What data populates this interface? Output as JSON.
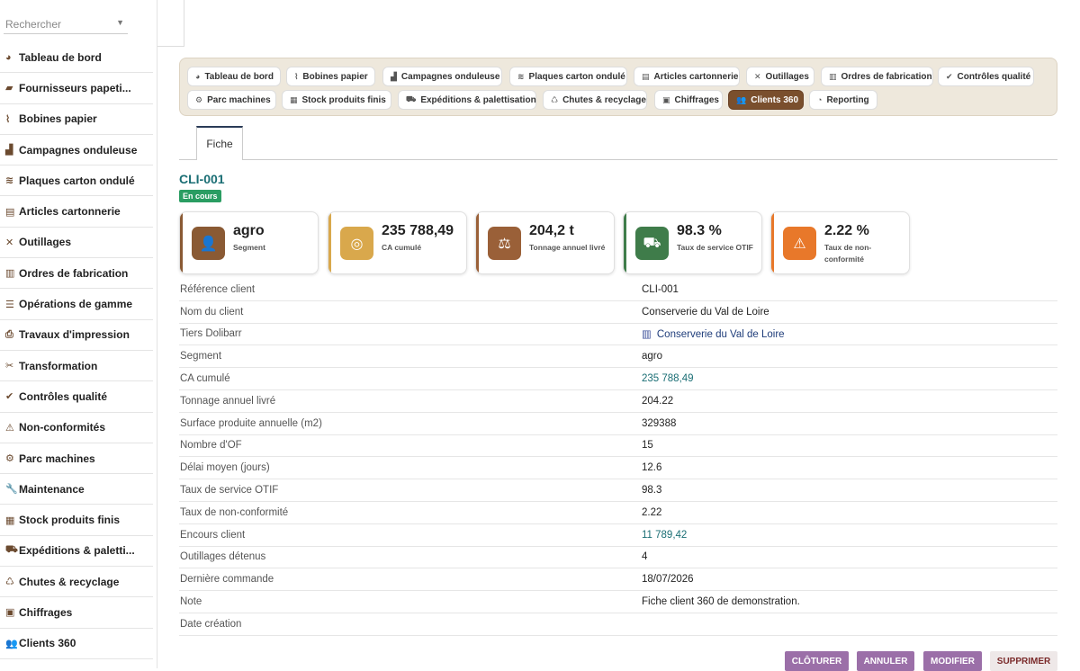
{
  "sidebar": {
    "search_placeholder": "Rechercher",
    "items": [
      {
        "icon": "gauge-icon",
        "glyph": "◕",
        "label": "Tableau de bord"
      },
      {
        "icon": "truck-paper-icon",
        "glyph": "▰",
        "label": "Fournisseurs papeti..."
      },
      {
        "icon": "paper-roll-icon",
        "glyph": "⌇",
        "label": "Bobines papier"
      },
      {
        "icon": "industry-icon",
        "glyph": "▟",
        "label": "Campagnes onduleuse"
      },
      {
        "icon": "layers-icon",
        "glyph": "≋",
        "label": "Plaques carton ondulé"
      },
      {
        "icon": "box-icon",
        "glyph": "▤",
        "label": "Articles cartonnerie"
      },
      {
        "icon": "tools-icon",
        "glyph": "✕",
        "label": "Outillages"
      },
      {
        "icon": "clipboard-icon",
        "glyph": "▥",
        "label": "Ordres de fabrication"
      },
      {
        "icon": "list-icon",
        "glyph": "☰",
        "label": "Opérations de gamme"
      },
      {
        "icon": "printer-icon",
        "glyph": "⎙",
        "label": "Travaux d'impression"
      },
      {
        "icon": "scissors-icon",
        "glyph": "✂",
        "label": "Transformation"
      },
      {
        "icon": "check-circle-icon",
        "glyph": "✔",
        "label": "Contrôles qualité"
      },
      {
        "icon": "warning-icon",
        "glyph": "⚠",
        "label": "Non-conformités"
      },
      {
        "icon": "cogs-icon",
        "glyph": "⚙",
        "label": "Parc machines"
      },
      {
        "icon": "wrench-icon",
        "glyph": "🔧",
        "label": "Maintenance"
      },
      {
        "icon": "warehouse-icon",
        "glyph": "▦",
        "label": "Stock produits finis"
      },
      {
        "icon": "shipping-icon",
        "glyph": "⛟",
        "label": "Expéditions & paletti..."
      },
      {
        "icon": "recycle-icon",
        "glyph": "♺",
        "label": "Chutes & recyclage"
      },
      {
        "icon": "calculator-icon",
        "glyph": "▣",
        "label": "Chiffrages"
      },
      {
        "icon": "users-icon",
        "glyph": "👥",
        "label": "Clients 360"
      }
    ]
  },
  "tabs": [
    {
      "icon": "gauge-icon",
      "glyph": "◕",
      "label": "Tableau de bord"
    },
    {
      "icon": "paper-roll-icon",
      "glyph": "⌇",
      "label": "Bobines papier"
    },
    {
      "icon": "industry-icon",
      "glyph": "▟",
      "label": "Campagnes onduleuse"
    },
    {
      "icon": "layers-icon",
      "glyph": "≋",
      "label": "Plaques carton ondulé"
    },
    {
      "icon": "box-icon",
      "glyph": "▤",
      "label": "Articles cartonnerie"
    },
    {
      "icon": "tools-icon",
      "glyph": "✕",
      "label": "Outillages"
    },
    {
      "icon": "clipboard-icon",
      "glyph": "▥",
      "label": "Ordres de fabrication"
    },
    {
      "icon": "check-circle-icon",
      "glyph": "✔",
      "label": "Contrôles qualité"
    },
    {
      "icon": "cogs-icon",
      "glyph": "⚙",
      "label": "Parc machines"
    },
    {
      "icon": "warehouse-icon",
      "glyph": "▦",
      "label": "Stock produits finis"
    },
    {
      "icon": "shipping-icon",
      "glyph": "⛟",
      "label": "Expéditions & palettisation"
    },
    {
      "icon": "recycle-icon",
      "glyph": "♺",
      "label": "Chutes & recyclage"
    },
    {
      "icon": "calculator-icon",
      "glyph": "▣",
      "label": "Chiffrages"
    },
    {
      "icon": "users-icon",
      "glyph": "👥",
      "label": "Clients 360",
      "active": true
    },
    {
      "icon": "chart-pie-icon",
      "glyph": "◔",
      "label": "Reporting"
    }
  ],
  "subtab": {
    "label": "Fiche"
  },
  "record": {
    "ref": "CLI-001",
    "status": "En cours"
  },
  "kpis": [
    {
      "icon": "user-tag-icon",
      "glyph": "👤",
      "value": "agro",
      "label": "Segment",
      "color": "#8a5a34",
      "icon_bg": "#8a5a34"
    },
    {
      "icon": "coins-icon",
      "glyph": "◎",
      "value": "235 788,49",
      "label": "CA cumulé",
      "color": "#d9a84c",
      "icon_bg": "#d9a84c"
    },
    {
      "icon": "balance-icon",
      "glyph": "⚖",
      "value": "204,2 t",
      "label": "Tonnage annuel livré",
      "color": "#9a6038",
      "icon_bg": "#9a6038"
    },
    {
      "icon": "truck-fast-icon",
      "glyph": "⛟",
      "value": "98.3 %",
      "label": "Taux de service OTIF",
      "color": "#3f7c4a",
      "icon_bg": "#3f7c4a"
    },
    {
      "icon": "warning-icon",
      "glyph": "⚠",
      "value": "2.22 %",
      "label": "Taux de non-conformité",
      "color": "#e8782a",
      "icon_bg": "#e8782a"
    }
  ],
  "fields": [
    {
      "key": "Référence client",
      "value": "CLI-001"
    },
    {
      "key": "Nom du client",
      "value": "Conserverie du Val de Loire"
    },
    {
      "key": "Tiers Dolibarr",
      "value": "Conserverie du Val de Loire",
      "type": "tiers"
    },
    {
      "key": "Segment",
      "value": "agro"
    },
    {
      "key": "CA cumulé",
      "value": "235 788,49",
      "type": "link"
    },
    {
      "key": "Tonnage annuel livré",
      "value": "204.22"
    },
    {
      "key": "Surface produite annuelle (m2)",
      "value": "329388"
    },
    {
      "key": "Nombre d'OF",
      "value": "15"
    },
    {
      "key": "Délai moyen (jours)",
      "value": "12.6"
    },
    {
      "key": "Taux de service OTIF",
      "value": "98.3"
    },
    {
      "key": "Taux de non-conformité",
      "value": "2.22"
    },
    {
      "key": "Encours client",
      "value": "11 789,42",
      "type": "link"
    },
    {
      "key": "Outillages détenus",
      "value": "4"
    },
    {
      "key": "Dernière commande",
      "value": "18/07/2026"
    },
    {
      "key": "Note",
      "value": "Fiche client 360 de demonstration."
    },
    {
      "key": "Date création",
      "value": ""
    }
  ],
  "actions": {
    "close": "CLÔTURER",
    "cancel": "ANNULER",
    "edit": "MODIFIER",
    "delete": "SUPPRIMER"
  }
}
